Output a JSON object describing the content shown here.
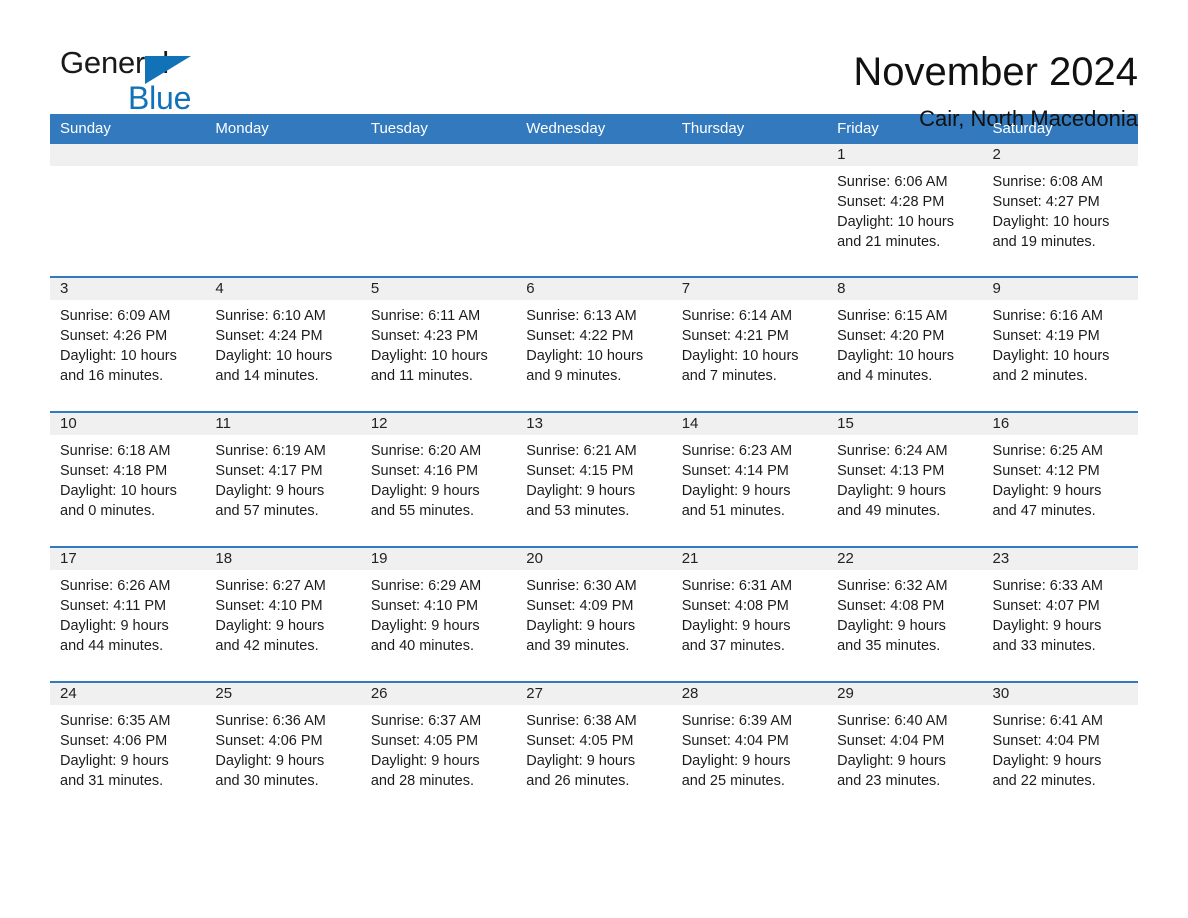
{
  "logo": {
    "word1": "General",
    "word2": "Blue",
    "accent_color": "#1272b8",
    "triangle_icon": "triangle-right-icon"
  },
  "header": {
    "title": "November 2024",
    "subtitle": "Cair, North Macedonia"
  },
  "calendar": {
    "header_bg": "#3279bd",
    "daynum_bg": "#f0f0f0",
    "weekdays": [
      "Sunday",
      "Monday",
      "Tuesday",
      "Wednesday",
      "Thursday",
      "Friday",
      "Saturday"
    ],
    "weeks": [
      [
        {
          "day": "",
          "lines": []
        },
        {
          "day": "",
          "lines": []
        },
        {
          "day": "",
          "lines": []
        },
        {
          "day": "",
          "lines": []
        },
        {
          "day": "",
          "lines": []
        },
        {
          "day": "1",
          "lines": [
            "Sunrise: 6:06 AM",
            "Sunset: 4:28 PM",
            "Daylight: 10 hours",
            "and 21 minutes."
          ]
        },
        {
          "day": "2",
          "lines": [
            "Sunrise: 6:08 AM",
            "Sunset: 4:27 PM",
            "Daylight: 10 hours",
            "and 19 minutes."
          ]
        }
      ],
      [
        {
          "day": "3",
          "lines": [
            "Sunrise: 6:09 AM",
            "Sunset: 4:26 PM",
            "Daylight: 10 hours",
            "and 16 minutes."
          ]
        },
        {
          "day": "4",
          "lines": [
            "Sunrise: 6:10 AM",
            "Sunset: 4:24 PM",
            "Daylight: 10 hours",
            "and 14 minutes."
          ]
        },
        {
          "day": "5",
          "lines": [
            "Sunrise: 6:11 AM",
            "Sunset: 4:23 PM",
            "Daylight: 10 hours",
            "and 11 minutes."
          ]
        },
        {
          "day": "6",
          "lines": [
            "Sunrise: 6:13 AM",
            "Sunset: 4:22 PM",
            "Daylight: 10 hours",
            "and 9 minutes."
          ]
        },
        {
          "day": "7",
          "lines": [
            "Sunrise: 6:14 AM",
            "Sunset: 4:21 PM",
            "Daylight: 10 hours",
            "and 7 minutes."
          ]
        },
        {
          "day": "8",
          "lines": [
            "Sunrise: 6:15 AM",
            "Sunset: 4:20 PM",
            "Daylight: 10 hours",
            "and 4 minutes."
          ]
        },
        {
          "day": "9",
          "lines": [
            "Sunrise: 6:16 AM",
            "Sunset: 4:19 PM",
            "Daylight: 10 hours",
            "and 2 minutes."
          ]
        }
      ],
      [
        {
          "day": "10",
          "lines": [
            "Sunrise: 6:18 AM",
            "Sunset: 4:18 PM",
            "Daylight: 10 hours",
            "and 0 minutes."
          ]
        },
        {
          "day": "11",
          "lines": [
            "Sunrise: 6:19 AM",
            "Sunset: 4:17 PM",
            "Daylight: 9 hours",
            "and 57 minutes."
          ]
        },
        {
          "day": "12",
          "lines": [
            "Sunrise: 6:20 AM",
            "Sunset: 4:16 PM",
            "Daylight: 9 hours",
            "and 55 minutes."
          ]
        },
        {
          "day": "13",
          "lines": [
            "Sunrise: 6:21 AM",
            "Sunset: 4:15 PM",
            "Daylight: 9 hours",
            "and 53 minutes."
          ]
        },
        {
          "day": "14",
          "lines": [
            "Sunrise: 6:23 AM",
            "Sunset: 4:14 PM",
            "Daylight: 9 hours",
            "and 51 minutes."
          ]
        },
        {
          "day": "15",
          "lines": [
            "Sunrise: 6:24 AM",
            "Sunset: 4:13 PM",
            "Daylight: 9 hours",
            "and 49 minutes."
          ]
        },
        {
          "day": "16",
          "lines": [
            "Sunrise: 6:25 AM",
            "Sunset: 4:12 PM",
            "Daylight: 9 hours",
            "and 47 minutes."
          ]
        }
      ],
      [
        {
          "day": "17",
          "lines": [
            "Sunrise: 6:26 AM",
            "Sunset: 4:11 PM",
            "Daylight: 9 hours",
            "and 44 minutes."
          ]
        },
        {
          "day": "18",
          "lines": [
            "Sunrise: 6:27 AM",
            "Sunset: 4:10 PM",
            "Daylight: 9 hours",
            "and 42 minutes."
          ]
        },
        {
          "day": "19",
          "lines": [
            "Sunrise: 6:29 AM",
            "Sunset: 4:10 PM",
            "Daylight: 9 hours",
            "and 40 minutes."
          ]
        },
        {
          "day": "20",
          "lines": [
            "Sunrise: 6:30 AM",
            "Sunset: 4:09 PM",
            "Daylight: 9 hours",
            "and 39 minutes."
          ]
        },
        {
          "day": "21",
          "lines": [
            "Sunrise: 6:31 AM",
            "Sunset: 4:08 PM",
            "Daylight: 9 hours",
            "and 37 minutes."
          ]
        },
        {
          "day": "22",
          "lines": [
            "Sunrise: 6:32 AM",
            "Sunset: 4:08 PM",
            "Daylight: 9 hours",
            "and 35 minutes."
          ]
        },
        {
          "day": "23",
          "lines": [
            "Sunrise: 6:33 AM",
            "Sunset: 4:07 PM",
            "Daylight: 9 hours",
            "and 33 minutes."
          ]
        }
      ],
      [
        {
          "day": "24",
          "lines": [
            "Sunrise: 6:35 AM",
            "Sunset: 4:06 PM",
            "Daylight: 9 hours",
            "and 31 minutes."
          ]
        },
        {
          "day": "25",
          "lines": [
            "Sunrise: 6:36 AM",
            "Sunset: 4:06 PM",
            "Daylight: 9 hours",
            "and 30 minutes."
          ]
        },
        {
          "day": "26",
          "lines": [
            "Sunrise: 6:37 AM",
            "Sunset: 4:05 PM",
            "Daylight: 9 hours",
            "and 28 minutes."
          ]
        },
        {
          "day": "27",
          "lines": [
            "Sunrise: 6:38 AM",
            "Sunset: 4:05 PM",
            "Daylight: 9 hours",
            "and 26 minutes."
          ]
        },
        {
          "day": "28",
          "lines": [
            "Sunrise: 6:39 AM",
            "Sunset: 4:04 PM",
            "Daylight: 9 hours",
            "and 25 minutes."
          ]
        },
        {
          "day": "29",
          "lines": [
            "Sunrise: 6:40 AM",
            "Sunset: 4:04 PM",
            "Daylight: 9 hours",
            "and 23 minutes."
          ]
        },
        {
          "day": "30",
          "lines": [
            "Sunrise: 6:41 AM",
            "Sunset: 4:04 PM",
            "Daylight: 9 hours",
            "and 22 minutes."
          ]
        }
      ]
    ]
  }
}
